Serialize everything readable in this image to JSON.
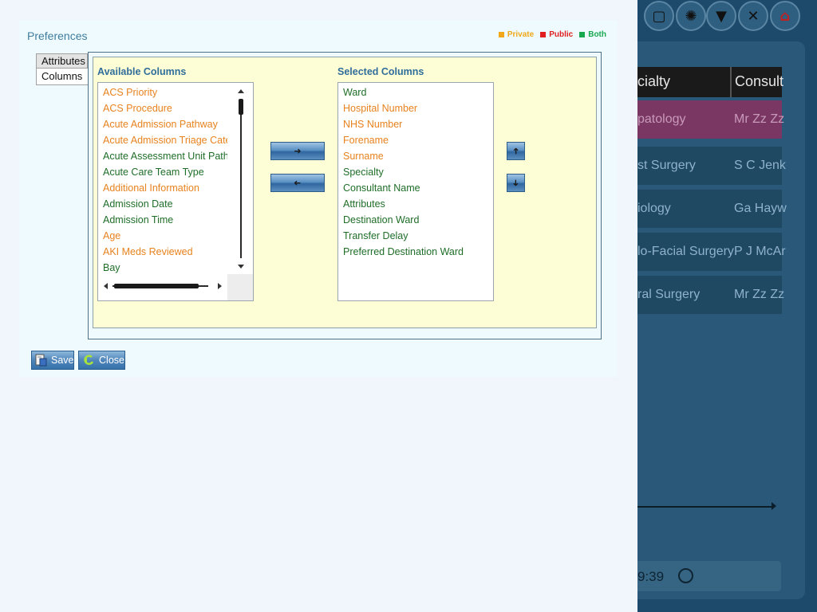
{
  "colors": {
    "private": "#f0a818",
    "public": "#e02020",
    "both": "#18a850",
    "private_text": "#e8821e",
    "both_text": "#1f6e28"
  },
  "background": {
    "toolbar_icons": [
      "clipboard-icon",
      "globe-icon",
      "filter-icon",
      "clear-icon",
      "home-icon"
    ],
    "grid": {
      "headers": [
        "cialty",
        "Consult"
      ],
      "rows": [
        {
          "specialty": "patology",
          "consultant": "Mr Zz Zz"
        },
        {
          "specialty": "st Surgery",
          "consultant": "S C Jenk"
        },
        {
          "specialty": "iology",
          "consultant": "Ga Hayw"
        },
        {
          "specialty": "lo-Facial Surgery",
          "consultant": "P J McAr"
        },
        {
          "specialty": "ral Surgery",
          "consultant": "Mr Zz Zz"
        }
      ]
    },
    "status_time": "9:39"
  },
  "dialog": {
    "title": "Preferences",
    "legend": [
      {
        "label": "Private",
        "key": "private"
      },
      {
        "label": "Public",
        "key": "public"
      },
      {
        "label": "Both",
        "key": "both"
      }
    ],
    "tabs": {
      "attributes": "Attributes",
      "columns": "Columns"
    },
    "available_label": "Available Columns",
    "selected_label": "Selected Columns",
    "available_columns": [
      {
        "label": "ACS Priority",
        "type": "private"
      },
      {
        "label": "ACS Procedure",
        "type": "private"
      },
      {
        "label": "Acute Admission Pathway",
        "type": "private"
      },
      {
        "label": "Acute Admission Triage Categ",
        "type": "private"
      },
      {
        "label": "Acute Assessment Unit Pathw",
        "type": "both"
      },
      {
        "label": "Acute Care Team Type",
        "type": "both"
      },
      {
        "label": "Additional Information",
        "type": "private"
      },
      {
        "label": "Admission Date",
        "type": "both"
      },
      {
        "label": "Admission Time",
        "type": "both"
      },
      {
        "label": "Age",
        "type": "private"
      },
      {
        "label": "AKI Meds Reviewed",
        "type": "private"
      },
      {
        "label": "Bay",
        "type": "both"
      }
    ],
    "selected_columns": [
      {
        "label": "Ward",
        "type": "both"
      },
      {
        "label": "Hospital Number",
        "type": "private"
      },
      {
        "label": "NHS Number",
        "type": "private"
      },
      {
        "label": "Forename",
        "type": "private"
      },
      {
        "label": "Surname",
        "type": "private"
      },
      {
        "label": "Specialty",
        "type": "both"
      },
      {
        "label": "Consultant Name",
        "type": "both"
      },
      {
        "label": "Attributes",
        "type": "both"
      },
      {
        "label": "Destination Ward",
        "type": "both"
      },
      {
        "label": "Transfer Delay",
        "type": "both"
      },
      {
        "label": "Preferred Destination Ward",
        "type": "both"
      }
    ],
    "buttons": {
      "save": "Save",
      "close": "Close"
    }
  }
}
